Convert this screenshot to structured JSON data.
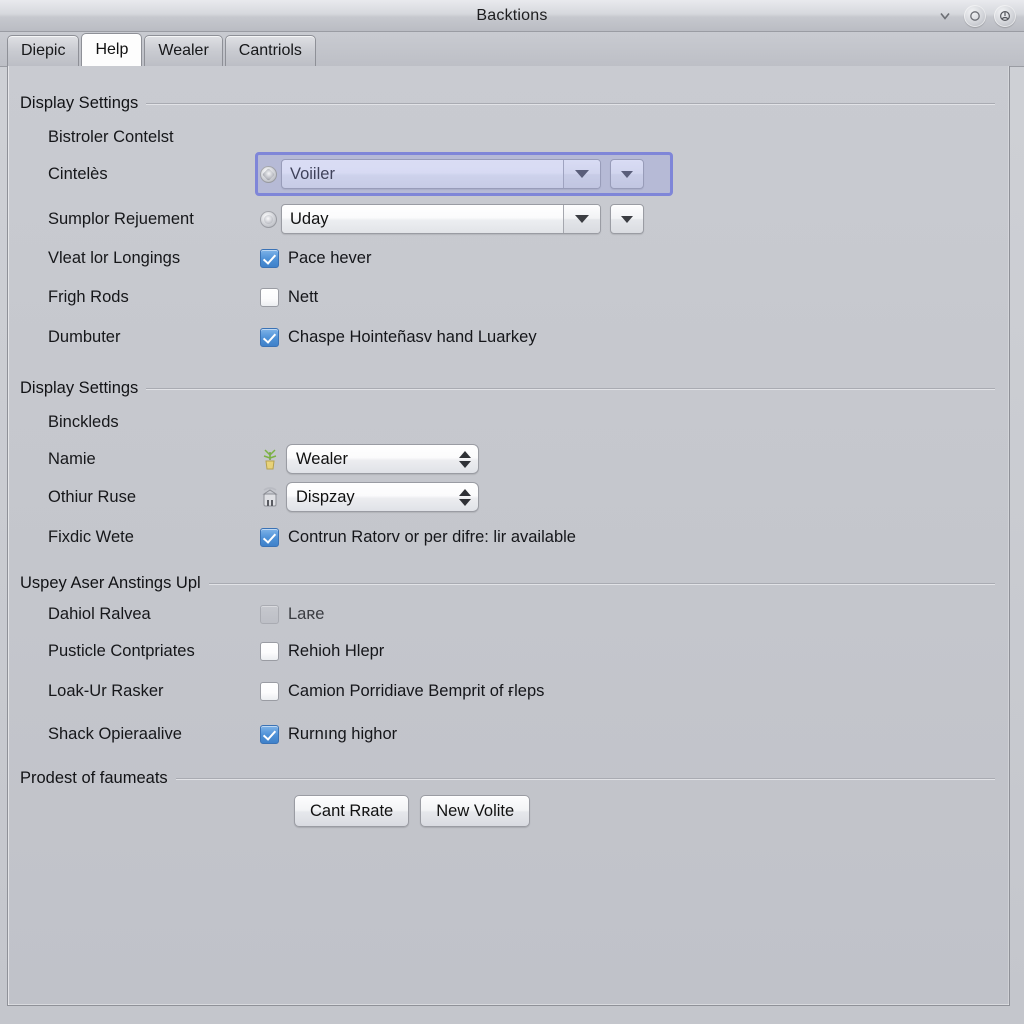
{
  "window": {
    "title": "Backtions",
    "controls": [
      {
        "name": "minimize-button",
        "glyph": "⌄"
      },
      {
        "name": "maximize-button",
        "glyph": "○"
      },
      {
        "name": "close-button",
        "glyph": "ⓧ"
      }
    ]
  },
  "tabs": [
    {
      "label": "Diepic",
      "active": false
    },
    {
      "label": "Help",
      "active": true
    },
    {
      "label": "Wealer",
      "active": false
    },
    {
      "label": "Cantriols",
      "active": false
    }
  ],
  "groups": [
    {
      "title": "Display Settings",
      "rows": [
        {
          "label": "Bistroler Contelst",
          "control": "none"
        },
        {
          "label": "Cintelès",
          "control": "combo",
          "value": "Voiiler",
          "focused": true
        },
        {
          "label": "Sumplor Rejuement",
          "control": "combo",
          "value": "Uday",
          "focused": false
        },
        {
          "label": "Vleat lor Longings",
          "control": "checkbox",
          "checked": true,
          "text": "Pace hever"
        },
        {
          "label": "Frigh Rods",
          "control": "checkbox",
          "checked": false,
          "text": "Nett"
        },
        {
          "label": "Dumbuter",
          "control": "checkbox",
          "checked": true,
          "text": "Chaspe Hointeñasv hand Luarkey"
        }
      ]
    },
    {
      "title": "Display Settings",
      "rows": [
        {
          "label": "Binckleds",
          "control": "none"
        },
        {
          "label": "Namie",
          "control": "spinner",
          "value": "Wealer"
        },
        {
          "label": "Othiur Ruse",
          "control": "spinner",
          "value": "Dispzay"
        },
        {
          "label": "Fixdic Wete",
          "control": "checkbox",
          "checked": true,
          "text": "Contrun Ratorv or per difre: lir available"
        }
      ]
    },
    {
      "title": "Uspey Aser Anstings Upl",
      "rows": [
        {
          "label": "Dahiol Ralvea",
          "control": "checkbox",
          "checked": false,
          "disabled": true,
          "text": "Laʀe"
        },
        {
          "label": "Pusticle Contpriates",
          "control": "checkbox",
          "checked": false,
          "text": "Rehioh Hlepr"
        },
        {
          "label": "Loak-Ur Rasker",
          "control": "checkbox",
          "checked": false,
          "text": "Camion Porridiave Bemprit of ғleps"
        },
        {
          "label": "Shack Opieraalive",
          "control": "checkbox",
          "checked": true,
          "text": "Rurnıng highor"
        }
      ]
    },
    {
      "title": "Prodest of faumeats",
      "buttons": [
        {
          "label": "Cant Rʀate"
        },
        {
          "label": "New Volite"
        }
      ]
    }
  ],
  "colors": {
    "accent_checkbox": "#4d90d6",
    "focus_ring": "#7f86d8",
    "panel_bg": "#c4c6cc",
    "tab_active_bg": "#fdfdfd"
  }
}
